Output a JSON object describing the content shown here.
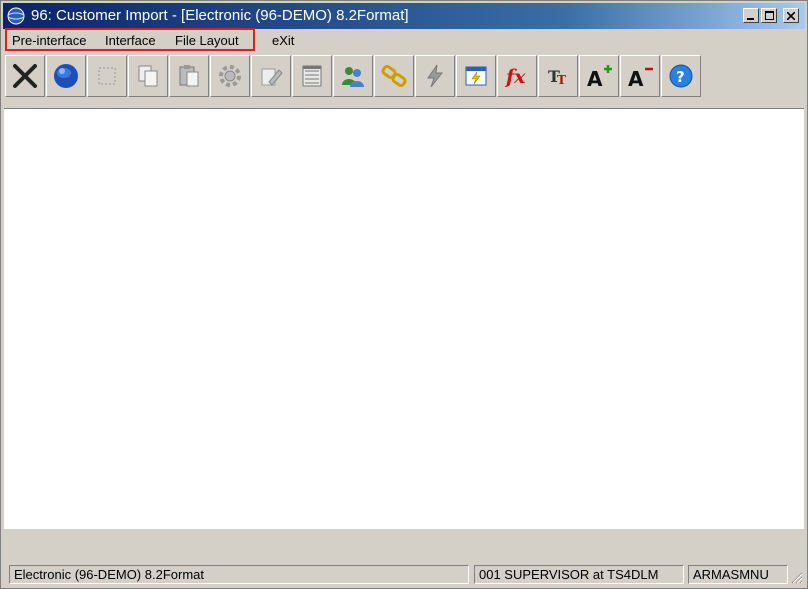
{
  "window": {
    "title": "96: Customer Import - [Electronic (96-DEMO) 8.2Format]"
  },
  "menubar": {
    "items": [
      "Pre-interface",
      "Interface",
      "File Layout",
      "eXit"
    ]
  },
  "toolbar": {
    "buttons": [
      {
        "icon": "delete-x-icon"
      },
      {
        "icon": "globe-icon"
      },
      {
        "icon": "select-box-icon"
      },
      {
        "icon": "copy-icon"
      },
      {
        "icon": "paste-icon"
      },
      {
        "icon": "gear-icon"
      },
      {
        "icon": "edit-pencil-icon"
      },
      {
        "icon": "list-icon"
      },
      {
        "icon": "users-icon"
      },
      {
        "icon": "link-icon"
      },
      {
        "icon": "lightning-icon"
      },
      {
        "icon": "calendar-run-icon"
      },
      {
        "icon": "fx-icon"
      },
      {
        "icon": "font-tt-icon"
      },
      {
        "icon": "font-increase-icon"
      },
      {
        "icon": "font-decrease-icon"
      },
      {
        "icon": "help-icon"
      }
    ]
  },
  "statusbar": {
    "format": "Electronic (96-DEMO) 8.2Format",
    "user": "001 SUPERVISOR at TS4DLM",
    "menu": "ARMASMNU"
  },
  "colors": {
    "title_gradient_start": "#0a246a",
    "highlight_border": "#e02020",
    "face": "#d4d0c8"
  }
}
